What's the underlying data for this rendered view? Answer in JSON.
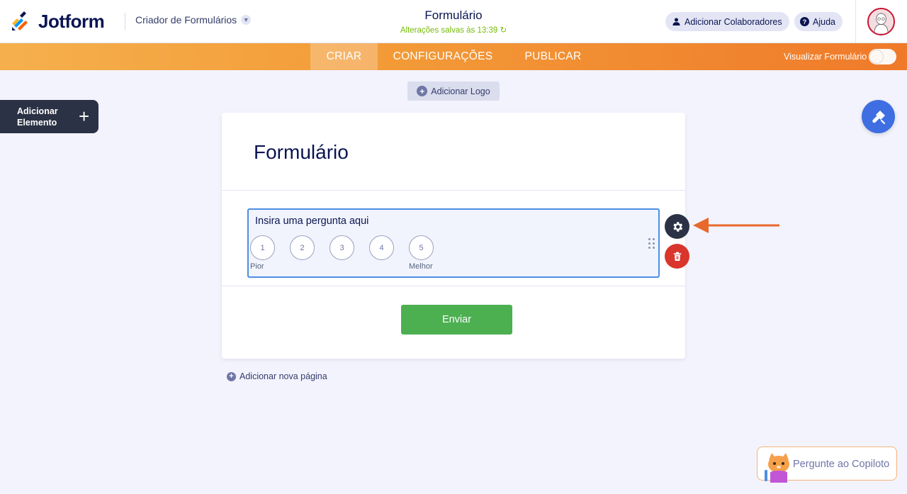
{
  "header": {
    "brand": "Jotform",
    "builder_label": "Criador de Formulários",
    "form_name": "Formulário",
    "saved_status": "Alterações salvas às 13:39",
    "collaborators_label": "Adicionar Colaboradores",
    "help_label": "Ajuda"
  },
  "nav": {
    "tabs": [
      {
        "label": "CRIAR",
        "active": true
      },
      {
        "label": "CONFIGURAÇÕES",
        "active": false
      },
      {
        "label": "PUBLICAR",
        "active": false
      }
    ],
    "preview_label": "Visualizar Formulário",
    "preview_on": false
  },
  "sidebar": {
    "add_element_label": "Adicionar Elemento"
  },
  "canvas": {
    "add_logo_label": "Adicionar Logo",
    "form_title": "Formulário",
    "question": {
      "label": "Insira uma pergunta aqui",
      "scale": [
        "1",
        "2",
        "3",
        "4",
        "5"
      ],
      "low_label": "Pior",
      "high_label": "Melhor"
    },
    "submit_label": "Enviar",
    "add_page_label": "Adicionar nova página"
  },
  "copilot": {
    "label": "Pergunte ao Copiloto"
  },
  "colors": {
    "accent_orange": "#f39c38",
    "primary_blue": "#3e6ee1",
    "submit_green": "#4caf50",
    "delete_red": "#d9352c",
    "arrow_orange": "#e8692c"
  }
}
